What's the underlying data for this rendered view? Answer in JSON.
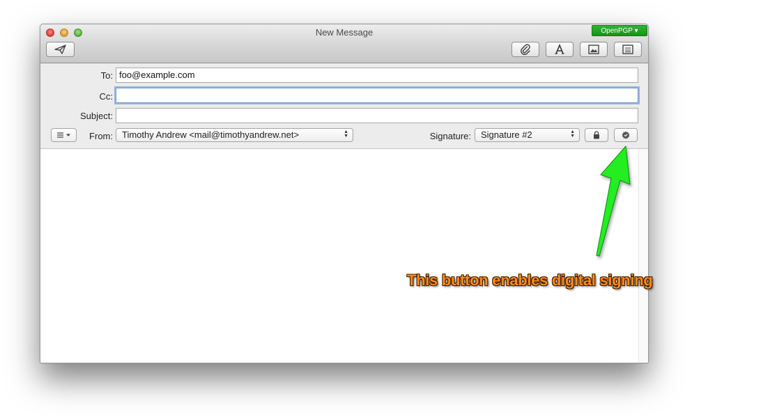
{
  "window": {
    "title": "New Message",
    "openpgp_label": "OpenPGP ▾"
  },
  "fields": {
    "to_label": "To:",
    "to_value": "foo@example.com",
    "cc_label": "Cc:",
    "cc_value": "",
    "subject_label": "Subject:",
    "subject_value": "",
    "from_label": "From:",
    "from_value": "Timothy Andrew <mail@timothyandrew.net>",
    "signature_label": "Signature:",
    "signature_value": "Signature #2"
  },
  "annotation": {
    "text": "This button enables digital signing",
    "text_color": "#ff8a1c",
    "arrow_color": "#22ee22"
  },
  "icons": [
    "send-icon",
    "paperclip-icon",
    "format-icon",
    "photo-browser-icon",
    "stationery-icon",
    "header-options-icon",
    "lock-icon",
    "sign-seal-icon"
  ]
}
